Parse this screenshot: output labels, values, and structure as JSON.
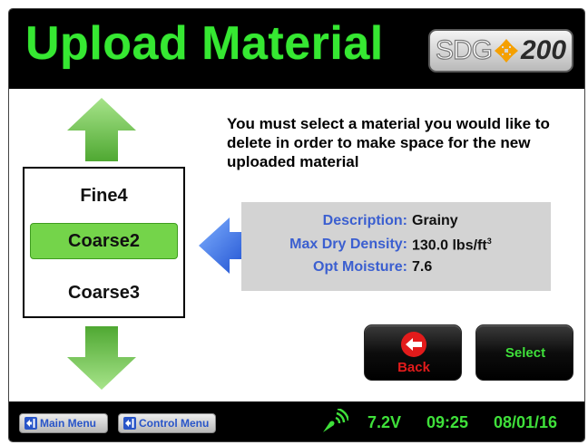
{
  "header": {
    "title": "Upload Material",
    "brand": {
      "prefix": "SDG",
      "model": "200"
    }
  },
  "instruction": "You must select a material you would like to delete in order to make space for the new uploaded material",
  "materials": {
    "items": [
      "Fine4",
      "Coarse2",
      "Coarse3"
    ],
    "selected": "Coarse2"
  },
  "details": {
    "description": {
      "label": "Description:",
      "value": "Grainy"
    },
    "max_dry_density": {
      "label": "Max Dry Density:",
      "value": "130.0 lbs/ft",
      "unit_exponent": "3"
    },
    "opt_moisture": {
      "label": "Opt Moisture:",
      "value": "7.6"
    }
  },
  "buttons": {
    "back": "Back",
    "select": "Select"
  },
  "footer": {
    "main_menu": "Main Menu",
    "control_menu": "Control Menu",
    "battery": "7.2V",
    "time": "09:25",
    "date": "08/01/16"
  },
  "colors": {
    "title_green": "#36e832",
    "status_green": "#3fe03a",
    "selected_item": "#74d44a",
    "label_blue": "#3b5fd0",
    "back_red": "#e31b1b",
    "panel_gray": "#d3d3d3"
  },
  "icons": [
    "up-arrow-icon",
    "down-arrow-icon",
    "left-pointer-arrow-icon",
    "back-arrow-icon",
    "signal-icon",
    "menu-icon"
  ]
}
